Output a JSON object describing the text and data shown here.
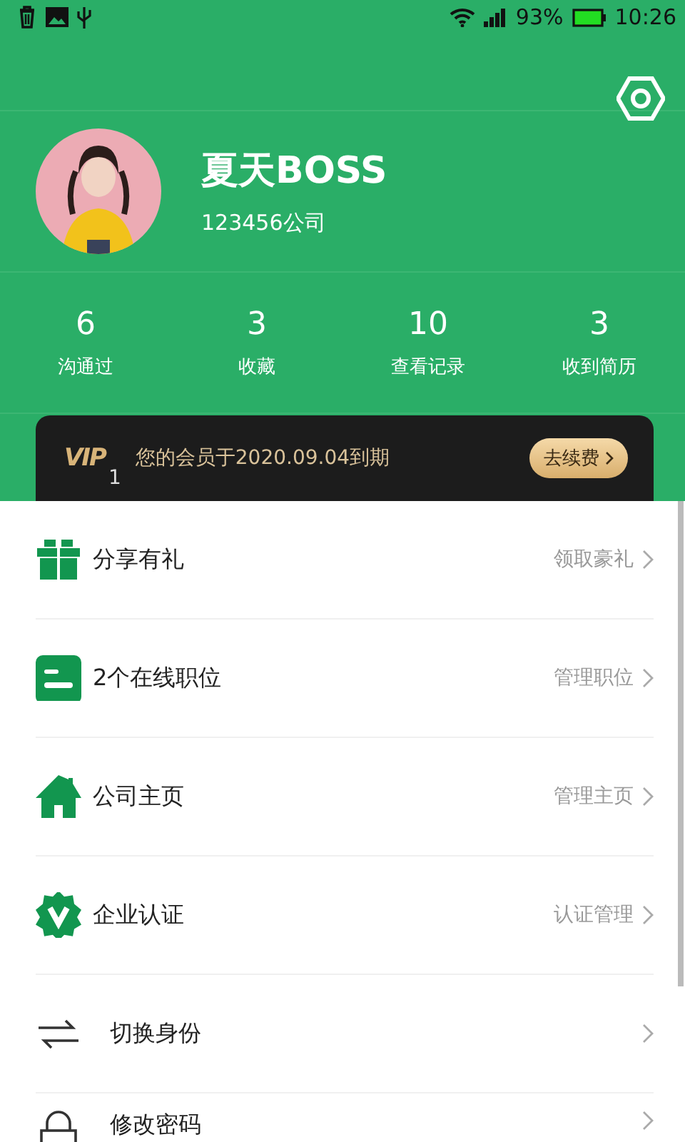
{
  "status_bar": {
    "battery": "93%",
    "time": "10:26"
  },
  "profile": {
    "name": "夏天BOSS",
    "company": "123456公司"
  },
  "stats": [
    {
      "value": "6",
      "label": "沟通过"
    },
    {
      "value": "3",
      "label": "收藏"
    },
    {
      "value": "10",
      "label": "查看记录"
    },
    {
      "value": "3",
      "label": "收到简历"
    }
  ],
  "vip": {
    "badge": "VIP",
    "level": "1",
    "message": "您的会员于2020.09.04到期",
    "button": "去续费"
  },
  "menu": [
    {
      "kind": "gift",
      "label": "分享有礼",
      "action": "领取豪礼"
    },
    {
      "kind": "jobs",
      "label": "2个在线职位",
      "action": "管理职位"
    },
    {
      "kind": "home",
      "label": "公司主页",
      "action": "管理主页"
    },
    {
      "kind": "verify",
      "label": "企业认证",
      "action": "认证管理"
    },
    {
      "kind": "switch",
      "label": "切换身份"
    },
    {
      "kind": "lock",
      "label": "修改密码"
    }
  ]
}
